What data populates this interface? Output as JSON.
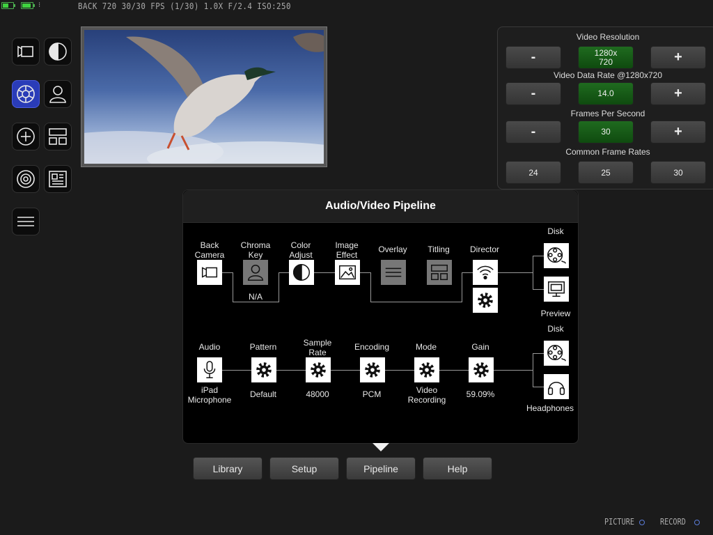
{
  "status": {
    "text": "BACK   720     30/30 FPS (1/30)  1.0X  F/2.4  ISO:250",
    "battery_color": "#3fd23f"
  },
  "tools": [
    {
      "name": "camera-tool-button",
      "icon": "video-camera-icon",
      "active": false
    },
    {
      "name": "color-adjust-tool-button",
      "icon": "half-circle-icon",
      "active": false
    },
    {
      "name": "settings-tool-button",
      "icon": "gear-icon",
      "active": true
    },
    {
      "name": "chroma-key-tool-button",
      "icon": "person-icon",
      "active": false
    },
    {
      "name": "add-tool-button",
      "icon": "plus-circle-icon",
      "active": false
    },
    {
      "name": "layout-tool-button",
      "icon": "layout-icon",
      "active": false
    },
    {
      "name": "target-tool-button",
      "icon": "target-icon",
      "active": false
    },
    {
      "name": "titling-tool-button",
      "icon": "news-icon",
      "active": false
    },
    {
      "name": "menu-tool-button",
      "icon": "menu-icon",
      "active": false
    }
  ],
  "settings": {
    "resolution_label": "Video Resolution",
    "resolution_value": "1280x\n720",
    "datarate_label": "Video Data Rate @1280x720",
    "datarate_value": "14.0",
    "fps_label": "Frames Per Second",
    "fps_value": "30",
    "common_label": "Common Frame Rates",
    "common_rates": [
      "24",
      "25",
      "30"
    ],
    "minus": "-",
    "plus": "+",
    "accent": "#1f6b1f"
  },
  "pipeline": {
    "title": "Audio/Video Pipeline",
    "video": {
      "back_camera": "Back\nCamera",
      "chroma_key": "Chroma\nKey",
      "chroma_sub": "N/A",
      "color_adjust": "Color\nAdjust",
      "image_effect": "Image\nEffect",
      "overlay": "Overlay",
      "titling": "Titling",
      "director": "Director",
      "disk": "Disk",
      "preview": "Preview"
    },
    "audio": {
      "audio": "Audio",
      "audio_sub": "iPad\nMicrophone",
      "pattern": "Pattern",
      "pattern_sub": "Default",
      "sample_rate": "Sample\nRate",
      "sample_rate_sub": "48000",
      "encoding": "Encoding",
      "encoding_sub": "PCM",
      "mode": "Mode",
      "mode_sub": "Video\nRecording",
      "gain": "Gain",
      "gain_sub": "59.09%",
      "disk": "Disk",
      "headphones": "Headphones"
    }
  },
  "tabs": [
    "Library",
    "Setup",
    "Pipeline",
    "Help"
  ],
  "bottom": {
    "picture": "PICTURE",
    "record": "RECORD"
  }
}
